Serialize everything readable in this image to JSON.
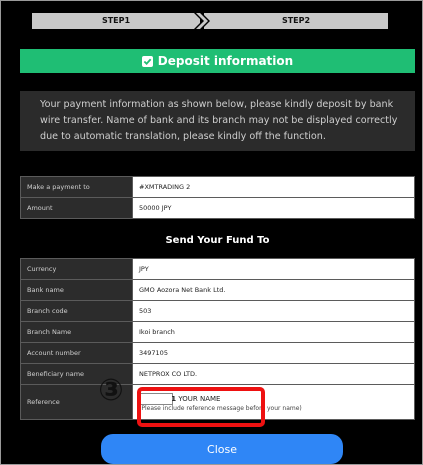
{
  "steps": {
    "step1": "STEP1",
    "step2": "STEP2"
  },
  "header": {
    "title": "Deposit information",
    "icon": "checkbox-checked-icon",
    "color": "#1fbe74"
  },
  "info_text": "Your payment information as shown below, please kindly deposit by bank wire transfer. Name of bank and its branch may not be displayed correctly due to automatic translation, please kindly off the function.",
  "summary": [
    {
      "label": "Make a payment to",
      "value": "#XMTRADING 2"
    },
    {
      "label": "Amount",
      "value": "50000 JPY"
    }
  ],
  "send_title": "Send Your Fund To",
  "bank_details": [
    {
      "label": "Currency",
      "value": "JPY"
    },
    {
      "label": "Bank name",
      "value": "GMO Aozora Net Bank Ltd."
    },
    {
      "label": "Branch code",
      "value": "503"
    },
    {
      "label": "Branch Name",
      "value": "Ikoi branch"
    },
    {
      "label": "Account number",
      "value": "3497105"
    },
    {
      "label": "Beneficiary name",
      "value": "NETPROX CO LTD."
    }
  ],
  "reference": {
    "label": "Reference",
    "id_tail": "1",
    "name": "YOUR NAME",
    "note": "(Please include reference message before your name)"
  },
  "annotation": {
    "number": "③",
    "outline_color": "#ee1111"
  },
  "close_label": "Close",
  "close_color": "#2f86f6"
}
